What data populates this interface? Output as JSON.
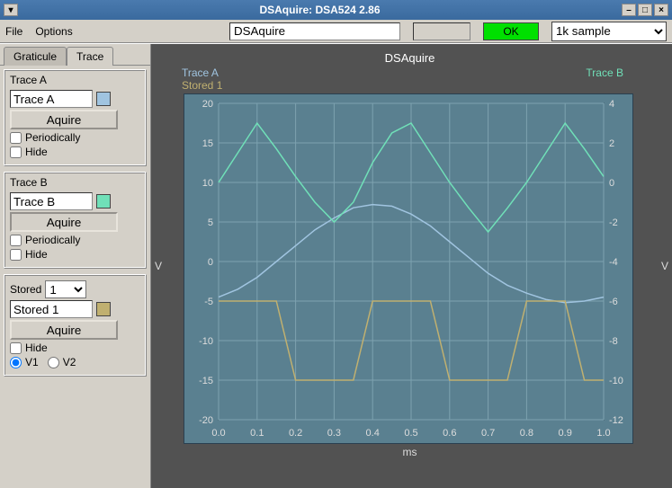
{
  "window": {
    "title": "DSAquire: DSA524 2.86"
  },
  "menubar": {
    "file": "File",
    "options": "Options",
    "name_field": "DSAquire",
    "ok_label": "OK",
    "sample_selected": "1k sample"
  },
  "tabs": {
    "graticule": "Graticule",
    "trace": "Trace"
  },
  "panels": {
    "traceA": {
      "title": "Trace A",
      "name": "Trace A",
      "color": "#a0c4e0",
      "acquire": "Aquire",
      "periodically": "Periodically",
      "hide": "Hide"
    },
    "traceB": {
      "title": "Trace B",
      "name": "Trace B",
      "color": "#70e0b8",
      "acquire": "Aquire",
      "periodically": "Periodically",
      "hide": "Hide"
    },
    "stored": {
      "title": "Stored",
      "selected": "1",
      "name": "Stored 1",
      "color": "#c0b070",
      "acquire": "Aquire",
      "hide": "Hide",
      "v1": "V1",
      "v2": "V2"
    }
  },
  "chart": {
    "title": "DSAquire",
    "legendA": "Trace A",
    "legendB": "Trace B",
    "legendS": "Stored 1",
    "ylabel_left": "V",
    "ylabel_right": "V",
    "xlabel": "ms"
  },
  "chart_data": {
    "type": "line",
    "xlabel": "ms",
    "x": [
      0.0,
      0.05,
      0.1,
      0.15,
      0.2,
      0.25,
      0.3,
      0.35,
      0.4,
      0.45,
      0.5,
      0.55,
      0.6,
      0.65,
      0.7,
      0.75,
      0.8,
      0.85,
      0.9,
      0.95,
      1.0
    ],
    "x_ticks": [
      0.0,
      0.1,
      0.2,
      0.3,
      0.4,
      0.5,
      0.6,
      0.7,
      0.8,
      0.9,
      1.0
    ],
    "left_axis": {
      "label": "V",
      "range": [
        -20,
        20
      ],
      "ticks": [
        -20,
        -15,
        -10,
        -5,
        0,
        5,
        10,
        15,
        20
      ]
    },
    "right_axis": {
      "label": "V",
      "range": [
        -12,
        4
      ],
      "ticks": [
        -12,
        -10,
        -8,
        -6,
        -4,
        -2,
        0,
        2,
        4
      ]
    },
    "series": [
      {
        "name": "Trace A",
        "axis": "left",
        "color": "#a0c4e0",
        "values": [
          -4.5,
          -3.5,
          -2.0,
          0.0,
          2.0,
          4.0,
          5.5,
          6.8,
          7.2,
          7.0,
          6.0,
          4.5,
          2.5,
          0.5,
          -1.5,
          -3.0,
          -4.0,
          -4.8,
          -5.2,
          -5.0,
          -4.5
        ]
      },
      {
        "name": "Trace B",
        "axis": "right",
        "color": "#70e0b8",
        "values": [
          0.0,
          1.5,
          3.0,
          1.7,
          0.3,
          -1.0,
          -2.0,
          -1.0,
          1.0,
          2.5,
          3.0,
          1.5,
          0.0,
          -1.3,
          -2.5,
          -1.3,
          0.0,
          1.5,
          3.0,
          1.7,
          0.3
        ]
      },
      {
        "name": "Stored 1",
        "axis": "left",
        "color": "#c0b070",
        "values": [
          -5,
          -5,
          -5,
          -5,
          -15,
          -15,
          -15,
          -15,
          -5,
          -5,
          -5,
          -5,
          -15,
          -15,
          -15,
          -15,
          -5,
          -5,
          -5,
          -15,
          -15
        ]
      }
    ]
  }
}
